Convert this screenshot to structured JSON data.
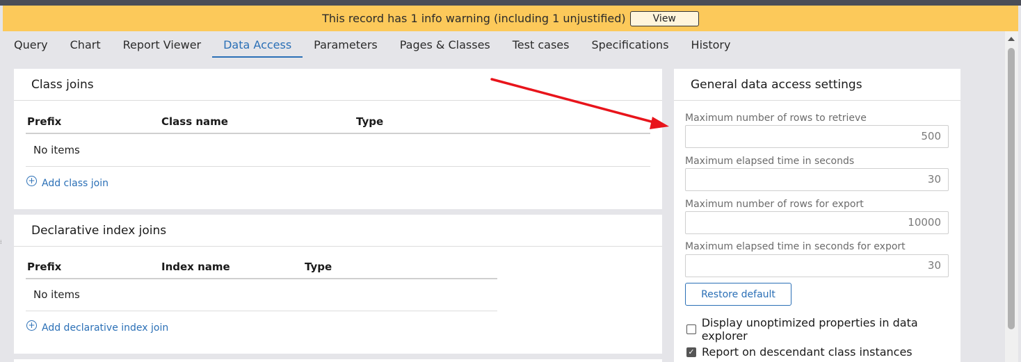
{
  "warning": {
    "text": "This record has 1 info warning (including 1 unjustified)",
    "view_label": "View"
  },
  "tabs": [
    {
      "label": "Query"
    },
    {
      "label": "Chart"
    },
    {
      "label": "Report Viewer"
    },
    {
      "label": "Data Access",
      "active": true
    },
    {
      "label": "Parameters"
    },
    {
      "label": "Pages & Classes"
    },
    {
      "label": "Test cases"
    },
    {
      "label": "Specifications"
    },
    {
      "label": "History"
    }
  ],
  "class_joins": {
    "title": "Class joins",
    "columns": [
      "Prefix",
      "Class name",
      "Type"
    ],
    "empty_text": "No items",
    "add_label": "Add class join"
  },
  "index_joins": {
    "title": "Declarative index joins",
    "columns": [
      "Prefix",
      "Index name",
      "Type"
    ],
    "empty_text": "No items",
    "add_label": "Add declarative index join"
  },
  "settings": {
    "title": "General data access settings",
    "fields": [
      {
        "label": "Maximum number of rows to retrieve",
        "value": "500"
      },
      {
        "label": "Maximum elapsed time in seconds",
        "value": "30"
      },
      {
        "label": "Maximum number of rows for export",
        "value": "10000"
      },
      {
        "label": "Maximum elapsed time in seconds for export",
        "value": "30"
      }
    ],
    "restore_label": "Restore default",
    "checkboxes": [
      {
        "label": "Display unoptimized properties in data explorer",
        "checked": false
      },
      {
        "label": "Report on descendant class instances",
        "checked": true
      }
    ]
  },
  "colors": {
    "warning_bg": "#fcc95a",
    "accent": "#2a6fb6",
    "annotation_arrow": "#e8141b"
  },
  "icons": {
    "add": "plus-circle-icon",
    "check": "check-icon",
    "scroll_up": "chevron-up-icon"
  }
}
